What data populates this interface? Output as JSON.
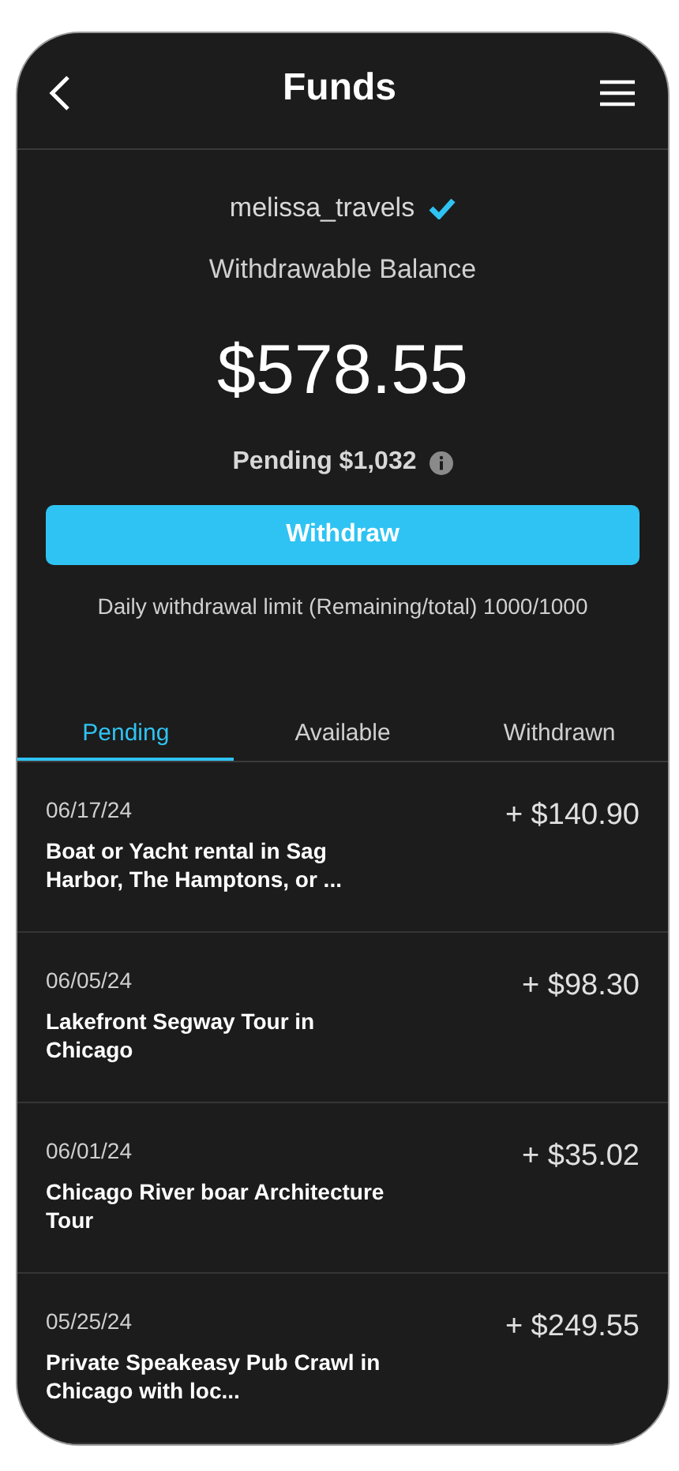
{
  "header": {
    "title": "Funds"
  },
  "account": {
    "username": "melissa_travels",
    "verified": true,
    "balance_label": "Withdrawable Balance",
    "balance": "$578.55",
    "pending": "Pending $1,032"
  },
  "withdraw_button": "Withdraw",
  "limit_note": "Daily withdrawal limit (Remaining/total) 1000/1000",
  "tabs": [
    {
      "label": "Pending",
      "selected": true
    },
    {
      "label": "Available",
      "selected": false
    },
    {
      "label": "Withdrawn",
      "selected": false
    }
  ],
  "transactions": [
    {
      "date": "06/17/24",
      "title": "Boat or Yacht rental in Sag Harbor, The Hamptons, or ...",
      "amount": "+ $140.90"
    },
    {
      "date": "06/05/24",
      "title": "Lakefront Segway Tour in Chicago",
      "amount": "+ $98.30"
    },
    {
      "date": "06/01/24",
      "title": "Chicago River boar Architecture Tour",
      "amount": "+ $35.02"
    },
    {
      "date": "05/25/24",
      "title": "Private Speakeasy Pub Crawl in Chicago with loc...",
      "amount": "+ $249.55"
    }
  ]
}
